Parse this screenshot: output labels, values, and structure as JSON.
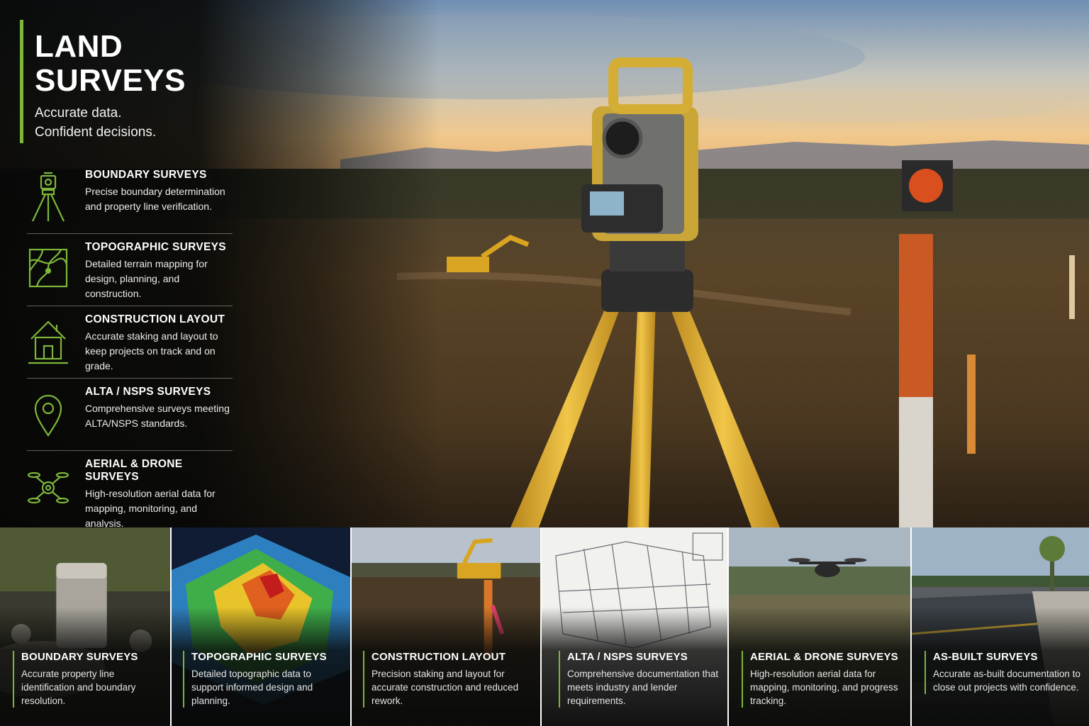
{
  "title": "LAND SURVEYS",
  "tagline_line1": "Accurate data.",
  "tagline_line2": "Confident decisions.",
  "accent_color": "#7db63a",
  "services": [
    {
      "icon": "tripod-icon",
      "title": "BOUNDARY SURVEYS",
      "description": "Precise boundary determination and property line verification."
    },
    {
      "icon": "topo-map-icon",
      "title": "TOPOGRAPHIC SURVEYS",
      "description": "Detailed terrain mapping for design, planning, and construction."
    },
    {
      "icon": "house-layout-icon",
      "title": "CONSTRUCTION LAYOUT",
      "description": "Accurate staking and layout to keep projects on track and on grade."
    },
    {
      "icon": "location-pin-icon",
      "title": "ALTA / NSPS SURVEYS",
      "description": "Comprehensive surveys meeting ALTA/NSPS standards."
    },
    {
      "icon": "drone-icon",
      "title": "AERIAL & DRONE SURVEYS",
      "description": "High-resolution aerial data for mapping, monitoring, and analysis."
    }
  ],
  "cards": [
    {
      "title": "BOUNDARY SURVEYS",
      "description": "Accurate property line identification and boundary resolution."
    },
    {
      "title": "TOPOGRAPHIC SURVEYS",
      "description": "Detailed topographic data to support informed design and planning."
    },
    {
      "title": "CONSTRUCTION LAYOUT",
      "description": "Precision staking and layout for accurate construction and reduced rework."
    },
    {
      "title": "ALTA / NSPS SURVEYS",
      "description": "Comprehensive documentation that meets industry and lender requirements."
    },
    {
      "title": "AERIAL & DRONE SURVEYS",
      "description": "High-resolution aerial data for mapping, monitoring, and progress tracking."
    },
    {
      "title": "AS-BUILT SURVEYS",
      "description": "Accurate as-built documentation to close out projects with confidence."
    }
  ]
}
